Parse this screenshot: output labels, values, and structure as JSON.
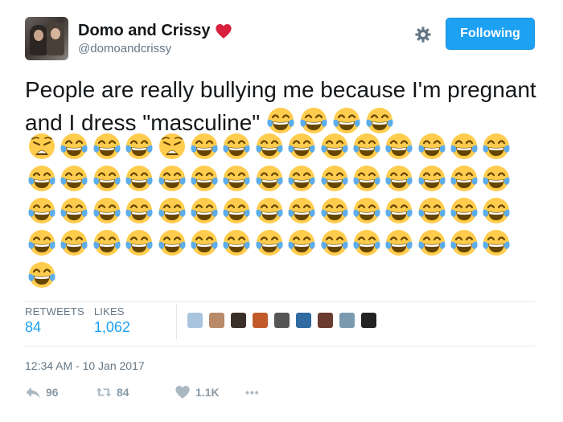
{
  "user": {
    "display_name": "Domo and Crissy",
    "handle": "@domoandcrissy",
    "follow_button_label": "Following"
  },
  "tweet": {
    "text": "People are really bullying me because I'm pregnant and I dress \"masculine\"",
    "emoji_sequence": [
      "joy",
      "joy",
      "joy",
      "joy",
      "weary",
      "joy",
      "joy",
      "joy",
      "weary",
      "joy",
      "joy",
      "joy",
      "joy",
      "joy",
      "joy",
      "joy",
      "joy",
      "joy",
      "joy",
      "joy",
      "joy",
      "joy",
      "joy",
      "joy",
      "joy",
      "joy",
      "joy",
      "joy",
      "joy",
      "joy",
      "joy",
      "joy",
      "joy",
      "joy",
      "joy",
      "joy",
      "joy",
      "joy",
      "joy",
      "joy",
      "joy",
      "joy",
      "joy",
      "joy",
      "joy",
      "joy",
      "joy",
      "joy",
      "joy",
      "joy",
      "joy",
      "joy",
      "joy",
      "joy",
      "joy",
      "joy",
      "joy",
      "joy",
      "joy",
      "joy",
      "joy",
      "joy",
      "joy",
      "joy",
      "joy"
    ]
  },
  "stats": {
    "retweets_label": "RETWEETS",
    "retweets_value": "84",
    "likes_label": "LIKES",
    "likes_value": "1,062"
  },
  "liker_avatar_colors": [
    "#a9c4de",
    "#b88a6a",
    "#3b2f2a",
    "#c25b2a",
    "#555555",
    "#2f6aa0",
    "#6a3b2f",
    "#7a9ab0",
    "#222222"
  ],
  "timestamp": "12:34 AM - 10 Jan 2017",
  "actions": {
    "reply_count": "96",
    "retweet_count": "84",
    "like_count": "1.1K",
    "more_label": "•••"
  },
  "colors": {
    "accent": "#1da1f2",
    "heart": "#e0245e",
    "muted": "#657786",
    "action_gray": "#8899a6"
  }
}
